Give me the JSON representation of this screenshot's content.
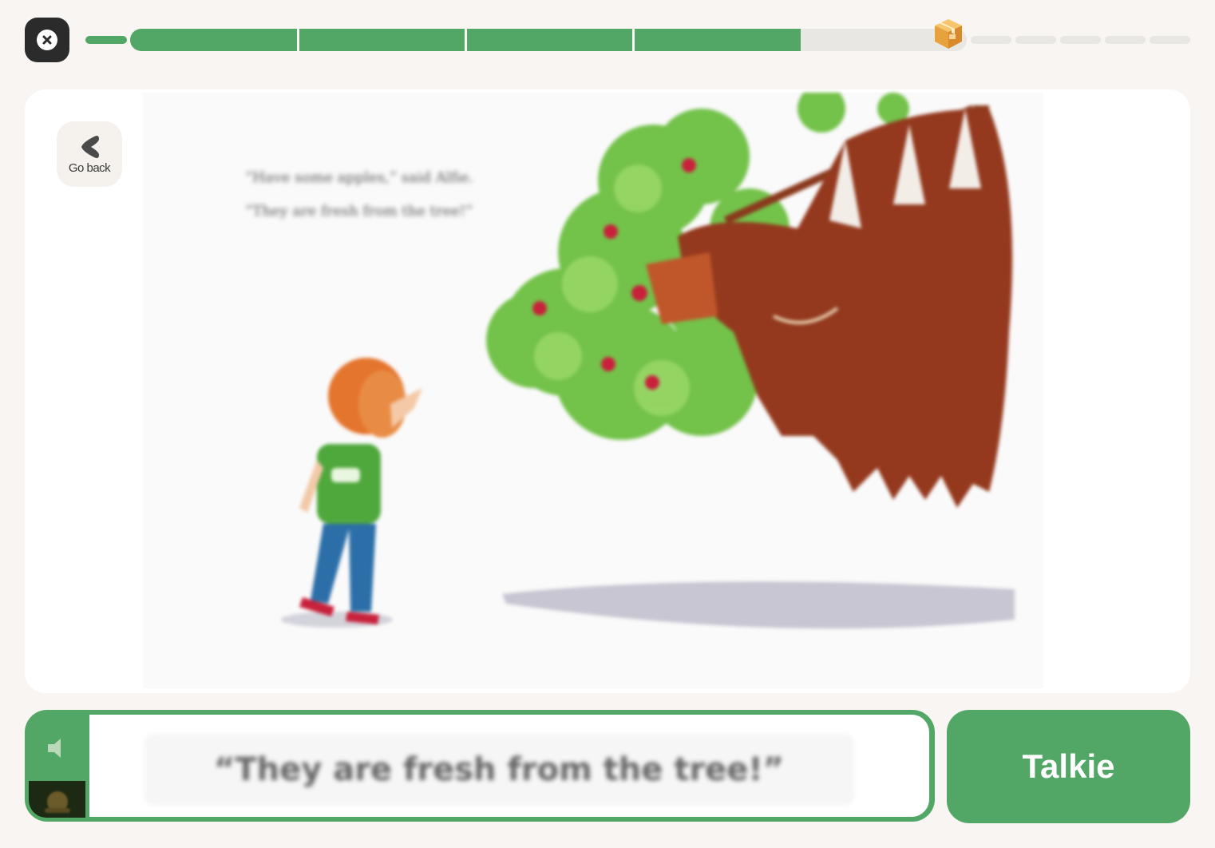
{
  "colors": {
    "brand_green": "#52a766",
    "background": "#f8f5f2",
    "close_dark": "#2b2b2b",
    "track_gray": "#e9e7e3"
  },
  "header": {
    "close_icon": "close-icon",
    "progress": {
      "intro_complete": true,
      "main_segments_total": 5,
      "main_segments_complete": 4,
      "reward_icon": "treasure-chest-icon",
      "remaining_small_segments": 5
    }
  },
  "story": {
    "go_back_label": "Go back",
    "go_back_icon": "chevron-left-icon",
    "page_text_lines": [
      "“Have some apples,” said Alfie.",
      "“They are fresh from the tree!”"
    ],
    "illustration": "boy-and-orangutan-apple-tree"
  },
  "reader": {
    "speaker_icon": "speaker-icon",
    "thumbnail_icon": "snail-icon",
    "sentence": "“They are fresh from the tree!”"
  },
  "talkie_label": "Talkie"
}
